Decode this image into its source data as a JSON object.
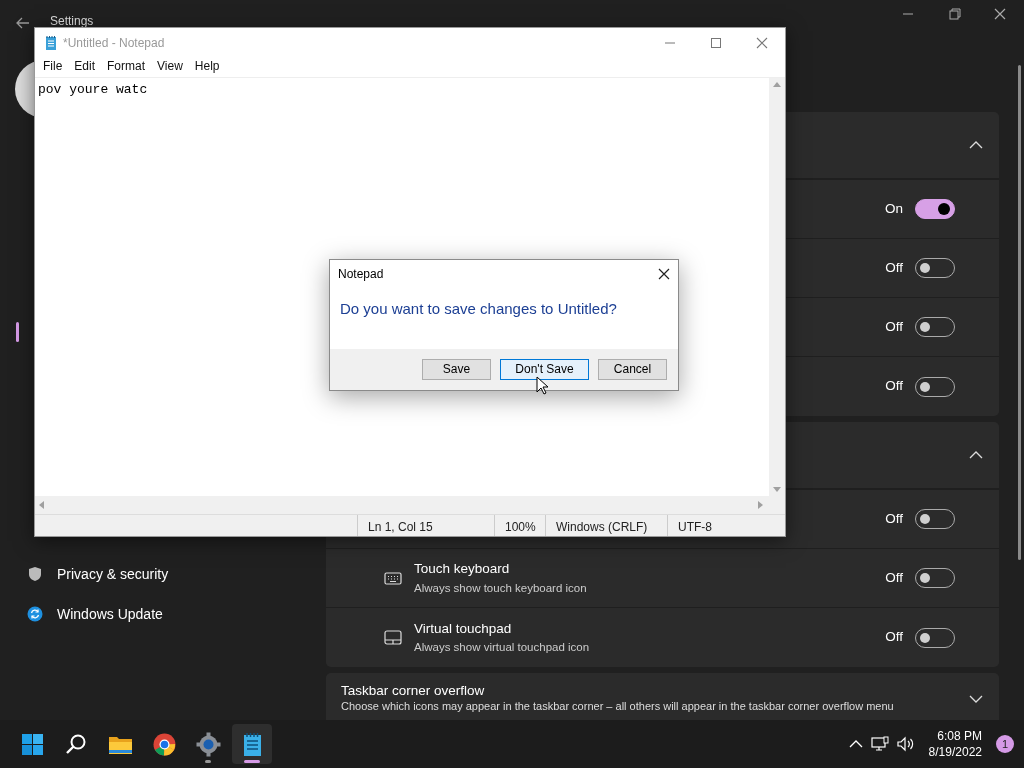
{
  "settings": {
    "title": "Settings",
    "nav": [
      {
        "label": "Privacy & security",
        "kind": "shield"
      },
      {
        "label": "Windows Update",
        "kind": "update"
      }
    ],
    "sections": [
      {
        "expanded": true,
        "rows": [
          {
            "state_label": "On",
            "on": true
          },
          {
            "state_label": "Off",
            "on": false
          },
          {
            "state_label": "Off",
            "on": false
          },
          {
            "state_label": "Off",
            "on": false
          }
        ]
      },
      {
        "expanded": true,
        "rows": [
          {
            "state_label": "Off",
            "on": false
          },
          {
            "title": "Touch keyboard",
            "subtitle": "Always show touch keyboard icon",
            "kind": "keyboard",
            "state_label": "Off",
            "on": false
          },
          {
            "title": "Virtual touchpad",
            "subtitle": "Always show virtual touchpad icon",
            "kind": "touchpad",
            "state_label": "Off",
            "on": false
          }
        ]
      },
      {
        "title": "Taskbar corner overflow",
        "subtitle": "Choose which icons may appear in the taskbar corner – all others will appear in the taskbar corner overflow menu",
        "expanded": false
      }
    ]
  },
  "notepad": {
    "title": "*Untitled - Notepad",
    "menu": [
      "File",
      "Edit",
      "Format",
      "View",
      "Help"
    ],
    "text": "pov youre watc",
    "status": [
      "Ln 1, Col 15",
      "100%",
      "Windows (CRLF)",
      "UTF-8"
    ]
  },
  "dialog": {
    "title": "Notepad",
    "message": "Do you want to save changes to Untitled?",
    "buttons": [
      {
        "label": "Save",
        "focused": false
      },
      {
        "label": "Don't Save",
        "focused": true
      },
      {
        "label": "Cancel",
        "focused": false
      }
    ]
  },
  "taskbar": {
    "apps": [
      {
        "kind": "start",
        "running": false,
        "active": false
      },
      {
        "kind": "search",
        "running": false,
        "active": false
      },
      {
        "kind": "explorer",
        "running": false,
        "active": false
      },
      {
        "kind": "browser",
        "running": false,
        "active": false
      },
      {
        "kind": "settings",
        "running": true,
        "active": false
      },
      {
        "kind": "notepad",
        "running": true,
        "active": true
      }
    ],
    "time": "6:08 PM",
    "date": "8/19/2022",
    "notifications": "1"
  }
}
